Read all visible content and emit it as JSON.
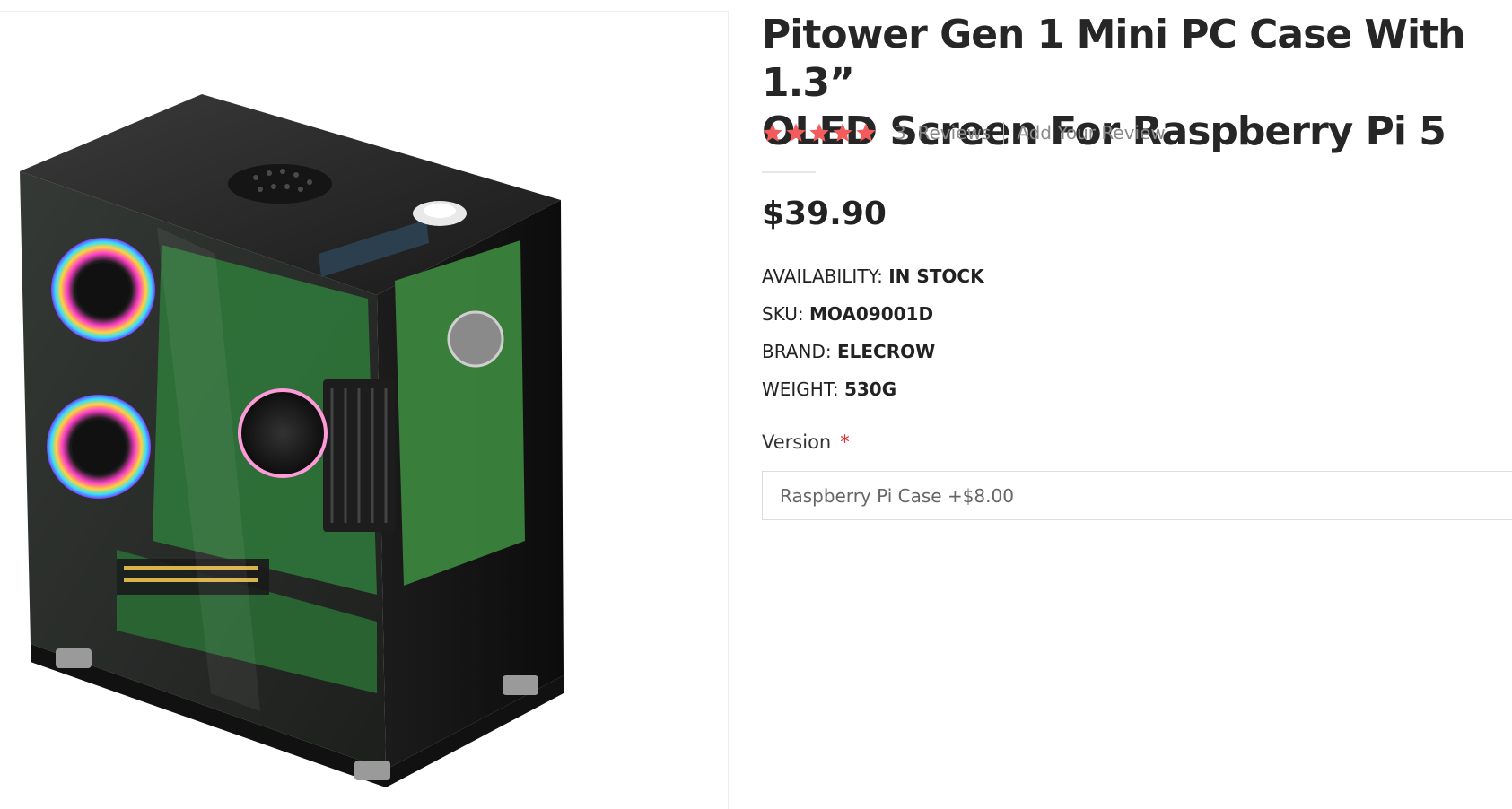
{
  "product": {
    "title_line1": "Pitower Gen 1 Mini PC Case With 1.3”",
    "title_line2": "OLED Screen For Raspberry Pi 5",
    "rating": {
      "stars": 5,
      "max": 5,
      "color": "#f25c5c"
    },
    "reviews_count": "3",
    "reviews_label": "Reviews",
    "add_review_label": "Add Your Review",
    "price": "$39.90",
    "attributes": {
      "availability": {
        "label": "AVAILABILITY:",
        "value": "IN STOCK"
      },
      "sku": {
        "label": "SKU:",
        "value": "MOA09001D"
      },
      "brand": {
        "label": "BRAND:",
        "value": "ELECROW"
      },
      "weight": {
        "label": "WEIGHT:",
        "value": "530G"
      }
    },
    "version": {
      "label": "Version",
      "required_mark": "*",
      "selected": "Raspberry Pi Case +$8.00"
    },
    "image": {
      "icon": "mini-pc-case-product-photo"
    }
  }
}
